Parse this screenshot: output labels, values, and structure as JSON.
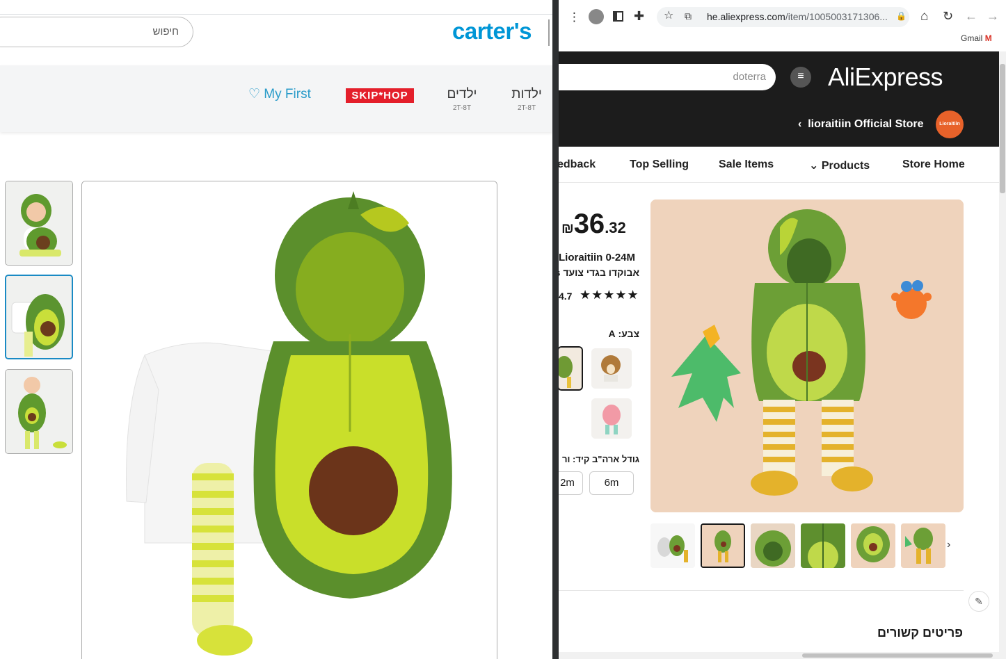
{
  "carters": {
    "search_placeholder": "חיפוש",
    "logo_text": "carter's",
    "nav": [
      {
        "label": "ילדות",
        "sub": "2T-8T"
      },
      {
        "label": "ילדים",
        "sub": "2T-8T"
      }
    ],
    "brand_skip_hop": "SKIP*HOP",
    "my_first": "♡ My First"
  },
  "browser": {
    "url_host": "he.aliexpress.com",
    "url_path": "/item/1005003171306...",
    "bookmark": "Gmail"
  },
  "aliexpress": {
    "logo": "AliExpress",
    "search_value": "doterra",
    "store_name": "lioraitiin Official Store",
    "store_logo_text": "Lioraitiin",
    "tabs": [
      "edback",
      "Top Selling",
      "Sale Items",
      "Products",
      "Store Home"
    ],
    "price": {
      "currency": "₪",
      "integer": "36",
      "decimal": ".32"
    },
    "title_line1": "Lioraitiin 0-24M",
    "title_line2": "אבוקדו בגדי צועד s",
    "rating": "4.7",
    "stars": "★★★★★",
    "color_label": "צבע: A",
    "size_label": "גודל ארה\"ב קיד: ור",
    "sizes": [
      "2m",
      "6m"
    ],
    "related_heading": "פריטים קשורים",
    "gallery_next": "›"
  }
}
